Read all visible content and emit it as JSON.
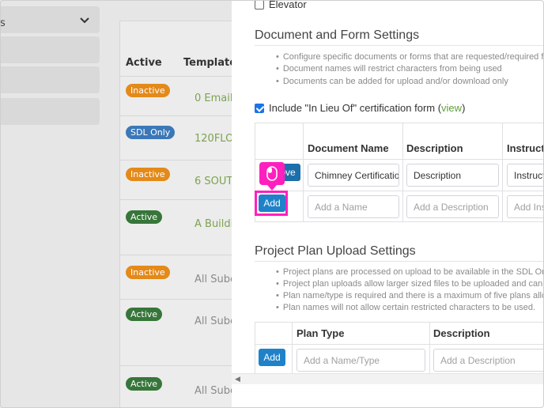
{
  "background": {
    "sidebar_item_text": "s",
    "table_headers": {
      "active": "Active",
      "template": "Template N"
    },
    "rows": [
      {
        "status": "Inactive",
        "status_type": "inactive",
        "name": "0  Emails",
        "name_style": "green"
      },
      {
        "status": "SDL Only",
        "status_type": "sdl",
        "name": "120FLO",
        "name_style": "green"
      },
      {
        "status": "Inactive",
        "status_type": "inactive",
        "name": "6 SOUT",
        "name_style": "green"
      },
      {
        "status": "Active",
        "status_type": "active",
        "name": "A Buildi",
        "name_style": "green"
      },
      {
        "status": "Inactive",
        "status_type": "inactive",
        "name": "All Subc",
        "name_style": "grey"
      },
      {
        "status": "Active",
        "status_type": "active",
        "name": "All Subc",
        "name_style": "grey"
      },
      {
        "status": "Active",
        "status_type": "active",
        "name": "All Subc",
        "name_style": "grey"
      }
    ]
  },
  "panel": {
    "elevator_label": "Elevator",
    "document_section": {
      "title": "Document and Form Settings",
      "bullets": [
        "Configure specific documents or forms that are requested/required f",
        "Document names will restrict characters from being used",
        "Documents can be added for upload and/or download only"
      ],
      "include_label": "Include \"In Lieu Of\" certification form (",
      "include_link": "view",
      "include_close": ")",
      "headers": {
        "name": "Document Name",
        "description": "Description",
        "instructions": "Instruct"
      },
      "row1": {
        "button": "ove",
        "name": "Chimney Certificatio",
        "description": "Description",
        "instructions": "Instruct"
      },
      "row2": {
        "button": "Add",
        "name_placeholder": "Add a Name",
        "description_placeholder": "Add a Description",
        "instructions_placeholder": "Add Ins"
      }
    },
    "plan_section": {
      "title": "Project Plan Upload Settings",
      "bullets": [
        "Project plans are processed on upload to be available in the SDL Onli",
        "Project plan uploads allow larger sized files to be uploaded and can o",
        "Plan name/type is required and there is a maximum of five plans allow",
        "Plan names will not allow certain restricted characters to be used."
      ],
      "headers": {
        "type": "Plan Type",
        "description": "Description"
      },
      "row": {
        "button": "Add",
        "type_placeholder": "Add a Name/Type",
        "description_placeholder": "Add a Description"
      }
    }
  },
  "colors": {
    "accent": "#1f82c9",
    "highlight": "#ff1fbf",
    "link": "#5e9e3a"
  }
}
